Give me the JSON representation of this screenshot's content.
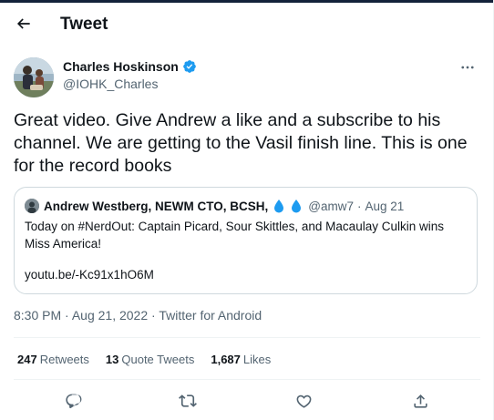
{
  "header": {
    "title": "Tweet"
  },
  "tweet": {
    "author_name": "Charles Hoskinson",
    "author_handle": "@IOHK_Charles",
    "text": "Great video. Give Andrew a like and a subscribe to his channel. We are getting to the Vasil finish line. This is one for the record books",
    "time": "8:30 PM",
    "date": "Aug 21, 2022",
    "source": "Twitter for Android",
    "separator": "·"
  },
  "quoted": {
    "author_name": "Andrew Westberg, NEWM CTO, BCSH,",
    "author_handle": "@amw7",
    "date": "Aug 21",
    "separator": "·",
    "text": "Today on #NerdOut: Captain Picard, Sour Skittles, and Macaulay Culkin wins Miss America!",
    "link": "youtu.be/-Kc91x1hO6M"
  },
  "stats": {
    "retweets_count": "247",
    "retweets_label": "Retweets",
    "quote_count": "13",
    "quote_label": "Quote Tweets",
    "likes_count": "1,687",
    "likes_label": "Likes"
  },
  "colors": {
    "verified": "#1d9bf0",
    "secondary_text": "#536471",
    "border": "#cfd9de"
  },
  "icons": {
    "back": "arrow-left-icon",
    "more": "more-horizontal-icon",
    "verified": "verified-badge-icon",
    "droplet": "droplet-icon",
    "reply": "reply-icon",
    "retweet": "retweet-icon",
    "like": "heart-icon",
    "share": "share-icon"
  }
}
